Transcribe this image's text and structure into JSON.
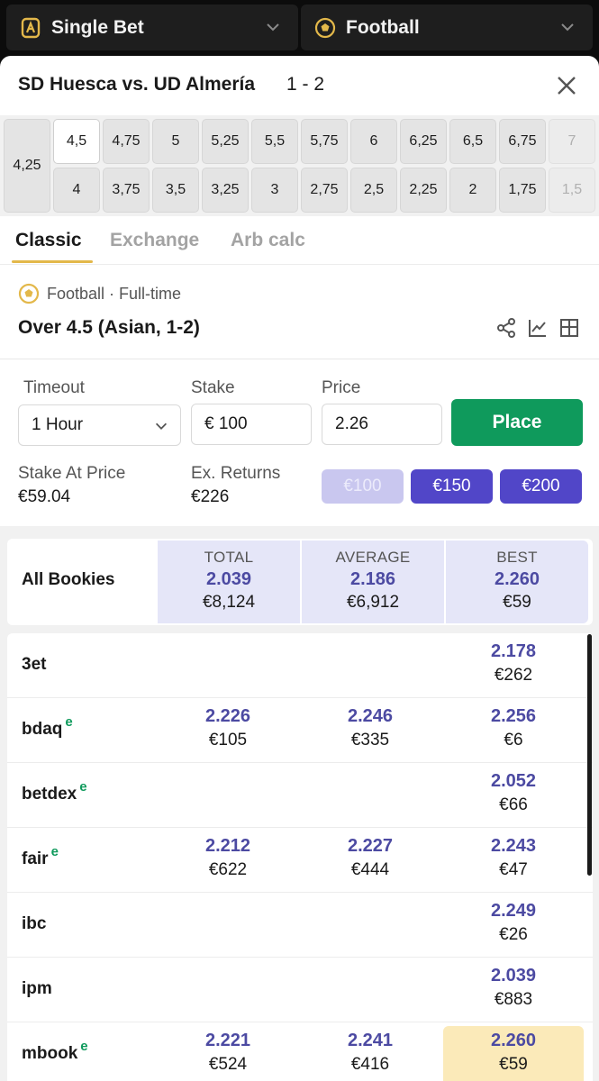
{
  "topbar": {
    "bet_type": "Single Bet",
    "sport": "Football"
  },
  "match": {
    "title": "SD Huesca vs. UD Almería",
    "score": "1 - 2"
  },
  "handicaps": {
    "left_single": "4,25",
    "top_row": [
      "4,5",
      "4,75",
      "5",
      "5,25",
      "5,5",
      "5,75",
      "6",
      "6,25",
      "6,5",
      "6,75",
      "7"
    ],
    "bottom_row": [
      "4",
      "3,75",
      "3,5",
      "3,25",
      "3",
      "2,75",
      "2,5",
      "2,25",
      "2",
      "1,75",
      "1,5"
    ],
    "selected": "4,5"
  },
  "tabs": [
    "Classic",
    "Exchange",
    "Arb calc"
  ],
  "market": {
    "sport_line": "Football · Full-time",
    "title": "Over 4.5 (Asian, 1-2)"
  },
  "form": {
    "timeout_label": "Timeout",
    "timeout_value": "1 Hour",
    "stake_label": "Stake",
    "stake_value": "€ 100",
    "price_label": "Price",
    "price_value": "2.26",
    "place_label": "Place",
    "stake_at_price_label": "Stake At Price",
    "stake_at_price_value": "€59.04",
    "ex_returns_label": "Ex. Returns",
    "ex_returns_value": "€226",
    "quick_stakes": [
      "€100",
      "€150",
      "€200"
    ]
  },
  "summary": {
    "name": "All Bookies",
    "columns": [
      {
        "header": "TOTAL",
        "price": "2.039",
        "stake": "€8,124"
      },
      {
        "header": "AVERAGE",
        "price": "2.186",
        "stake": "€6,912"
      },
      {
        "header": "BEST",
        "price": "2.260",
        "stake": "€59"
      }
    ]
  },
  "bookies": [
    {
      "name": "3et",
      "exchange": "",
      "c1p": "",
      "c1s": "",
      "c2p": "",
      "c2s": "",
      "c3p": "2.178",
      "c3s": "€262"
    },
    {
      "name": "bdaq",
      "exchange": "e",
      "c1p": "2.226",
      "c1s": "€105",
      "c2p": "2.246",
      "c2s": "€335",
      "c3p": "2.256",
      "c3s": "€6"
    },
    {
      "name": "betdex",
      "exchange": "e",
      "c1p": "",
      "c1s": "",
      "c2p": "",
      "c2s": "",
      "c3p": "2.052",
      "c3s": "€66"
    },
    {
      "name": "fair",
      "exchange": "e",
      "c1p": "2.212",
      "c1s": "€622",
      "c2p": "2.227",
      "c2s": "€444",
      "c3p": "2.243",
      "c3s": "€47"
    },
    {
      "name": "ibc",
      "exchange": "",
      "c1p": "",
      "c1s": "",
      "c2p": "",
      "c2s": "",
      "c3p": "2.249",
      "c3s": "€26"
    },
    {
      "name": "ipm",
      "exchange": "",
      "c1p": "",
      "c1s": "",
      "c2p": "",
      "c2s": "",
      "c3p": "2.039",
      "c3s": "€883"
    },
    {
      "name": "mbook",
      "exchange": "e",
      "c1p": "2.221",
      "c1s": "€524",
      "c2p": "2.241",
      "c2s": "€416",
      "c3p": "2.260",
      "c3s": "€59"
    }
  ],
  "colors": {
    "accent_price": "#4c4aa2",
    "place_button": "#0f9a5c",
    "quick_button": "#5146c8",
    "best_highlight": "#fbeab9",
    "tab_underline": "#e3b84a"
  }
}
